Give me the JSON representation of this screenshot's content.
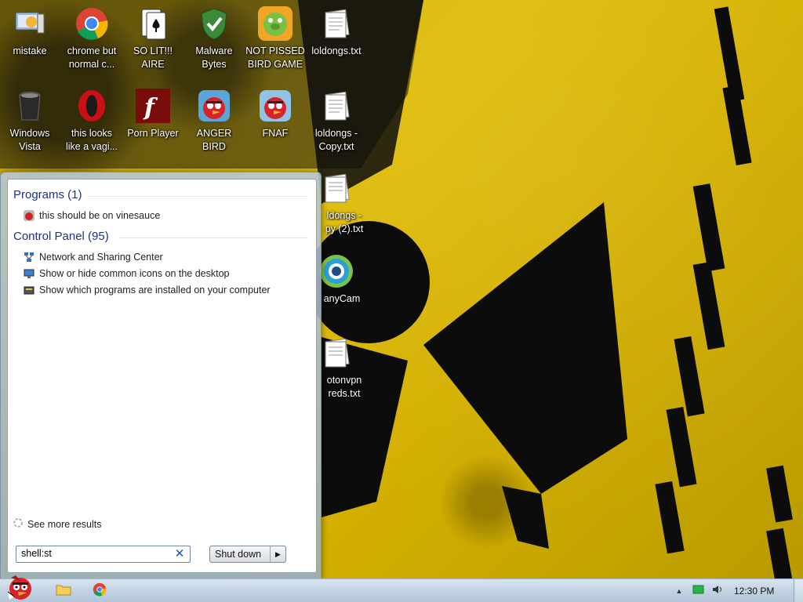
{
  "desktop": {
    "icons": [
      {
        "label": "mistake",
        "icon": "monitor-user-icon"
      },
      {
        "label": "chrome but\nnormal c...",
        "icon": "chrome-icon"
      },
      {
        "label": "SO LIT!!!\nAIRE",
        "icon": "playing-card-icon"
      },
      {
        "label": "Malware\nBytes",
        "icon": "shield-check-icon"
      },
      {
        "label": "NOT PISSED\nBIRD GAME",
        "icon": "green-pig-icon"
      },
      {
        "label": "loldongs.txt",
        "icon": "text-file-icon"
      },
      {
        "label": "Windows\nVista",
        "icon": "recycle-bin-icon"
      },
      {
        "label": "this looks\nlike a vagi...",
        "icon": "opera-icon"
      },
      {
        "label": "Porn Player",
        "icon": "flash-icon"
      },
      {
        "label": "ANGER\nBIRD",
        "icon": "red-bird-icon"
      },
      {
        "label": "FNAF",
        "icon": "red-bird-icon"
      },
      {
        "label": "loldongs -\nCopy.txt",
        "icon": "text-file-icon"
      },
      {
        "label": "ldongs -\npy (2).txt",
        "icon": "text-file-icon"
      },
      {
        "label": "anyCam",
        "icon": "webcam-icon"
      },
      {
        "label": "otonvpn\nreds.txt",
        "icon": "text-file-icon"
      }
    ]
  },
  "start_menu": {
    "groups": [
      {
        "title": "Programs (1)",
        "items": [
          {
            "label": "this should be on vinesauce",
            "icon": "bird-game-icon"
          }
        ]
      },
      {
        "title": "Control Panel (95)",
        "items": [
          {
            "label": "Network and Sharing Center",
            "icon": "network-icon"
          },
          {
            "label": "Show or hide common icons on the desktop",
            "icon": "display-icon"
          },
          {
            "label": "Show which programs are installed on your computer",
            "icon": "programs-icon"
          }
        ]
      }
    ],
    "see_more": "See more results",
    "search_value": "shell:st",
    "shutdown_label": "Shut down"
  },
  "taskbar": {
    "clock": "12:30 PM"
  },
  "colors": {
    "group_title": "#1e3287",
    "taskbar_top": "#d9e4ef",
    "wallpaper_yellow": "#e0bd0a"
  }
}
